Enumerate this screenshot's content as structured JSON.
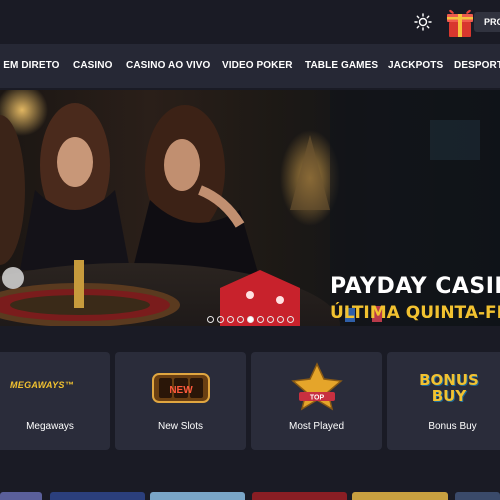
{
  "header": {
    "promo_label": "PROMOÇÕES",
    "icons": [
      "sun-icon",
      "gift-icon"
    ]
  },
  "nav": {
    "items": [
      {
        "label": "AO VIVO EM DIRETO"
      },
      {
        "label": "CASINO"
      },
      {
        "label": "CASINO AO VIVO"
      },
      {
        "label": "VIDEO POKER"
      },
      {
        "label": "TABLE GAMES"
      },
      {
        "label": "JACKPOTS"
      },
      {
        "label": "DESPORTOS"
      }
    ]
  },
  "banner": {
    "title": "PAYDAY CASINO",
    "subtitle": "ÚLTIMA QUINTA-FEIRA",
    "slide_count": 9,
    "active_slide_index": 4
  },
  "categories": [
    {
      "label": "Megaways",
      "logo_text": "MEGAWAYS™",
      "icon": "megaways-logo-icon"
    },
    {
      "label": "New Slots",
      "logo_text": "NEW",
      "icon": "slot-reels-icon"
    },
    {
      "label": "Most Played",
      "logo_text": "TOP",
      "icon": "star-icon"
    },
    {
      "label": "Bonus Buy",
      "logo_text": "BONUS BUY",
      "icon": "bonus-buy-logo-icon"
    }
  ],
  "colors": {
    "background": "#1a1b25",
    "nav_background": "#262835",
    "card_background": "#2a2c3a",
    "accent_yellow": "#f2c230"
  }
}
